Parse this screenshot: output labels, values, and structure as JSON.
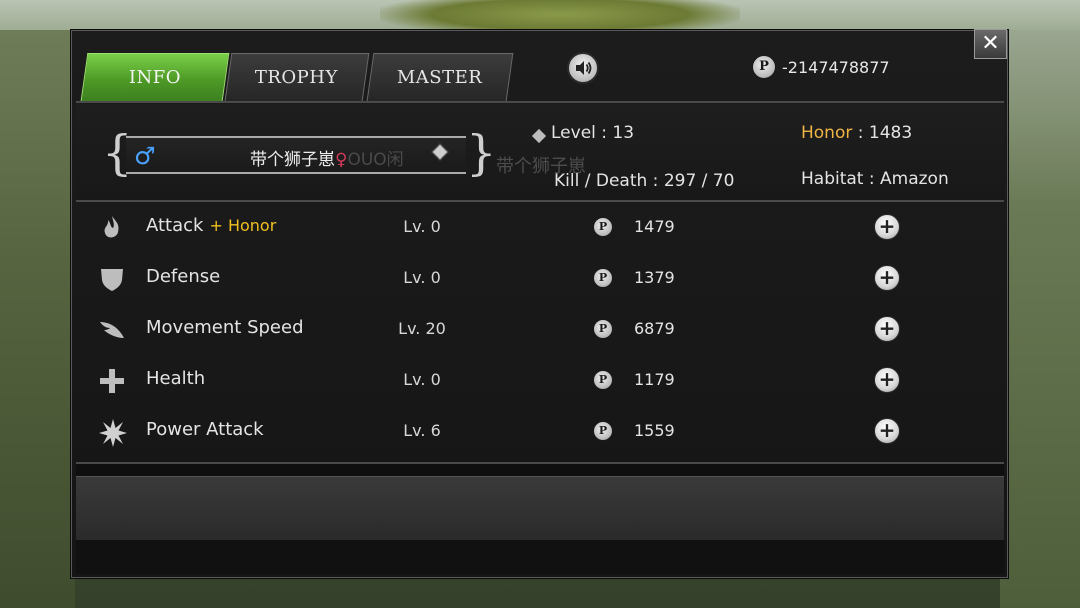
{
  "tabs": [
    {
      "label": "INFO",
      "active": true
    },
    {
      "label": "TROPHY",
      "active": false
    },
    {
      "label": "MASTER",
      "active": false
    }
  ],
  "currency": {
    "icon": "p-coin-icon",
    "value": "-2147478877"
  },
  "profile": {
    "name": "带个狮子崽",
    "suffix_symbol": "♀",
    "suffix_text": "OUO闲",
    "gender": "male",
    "ghost_name": "带个狮子崽"
  },
  "stats": {
    "level_label": "Level",
    "level": "13",
    "kd_label": "Kill / Death",
    "kd": "297 / 70",
    "honor_label": "Honor",
    "honor": "1483",
    "habitat_label": "Habitat",
    "habitat": "Amazon",
    "sep": ":"
  },
  "upgrades": [
    {
      "icon": "flame-icon",
      "name": "Attack",
      "extra": "+ Honor",
      "level": "Lv. 0",
      "cost": "1479"
    },
    {
      "icon": "shield-icon",
      "name": "Defense",
      "extra": "",
      "level": "Lv. 0",
      "cost": "1379"
    },
    {
      "icon": "wing-icon",
      "name": "Movement Speed",
      "extra": "",
      "level": "Lv. 20",
      "cost": "6879"
    },
    {
      "icon": "cross-icon",
      "name": "Health",
      "extra": "",
      "level": "Lv. 0",
      "cost": "1179"
    },
    {
      "icon": "burst-icon",
      "name": "Power Attack",
      "extra": "",
      "level": "Lv. 6",
      "cost": "1559"
    }
  ],
  "coin_symbol": "P",
  "plus_symbol": "+",
  "close_symbol": "✕",
  "colors": {
    "active_tab": "#5cb833",
    "honor_gold": "#f0b445",
    "male_blue": "#4aa3ff",
    "female_red": "#d23a5a"
  }
}
